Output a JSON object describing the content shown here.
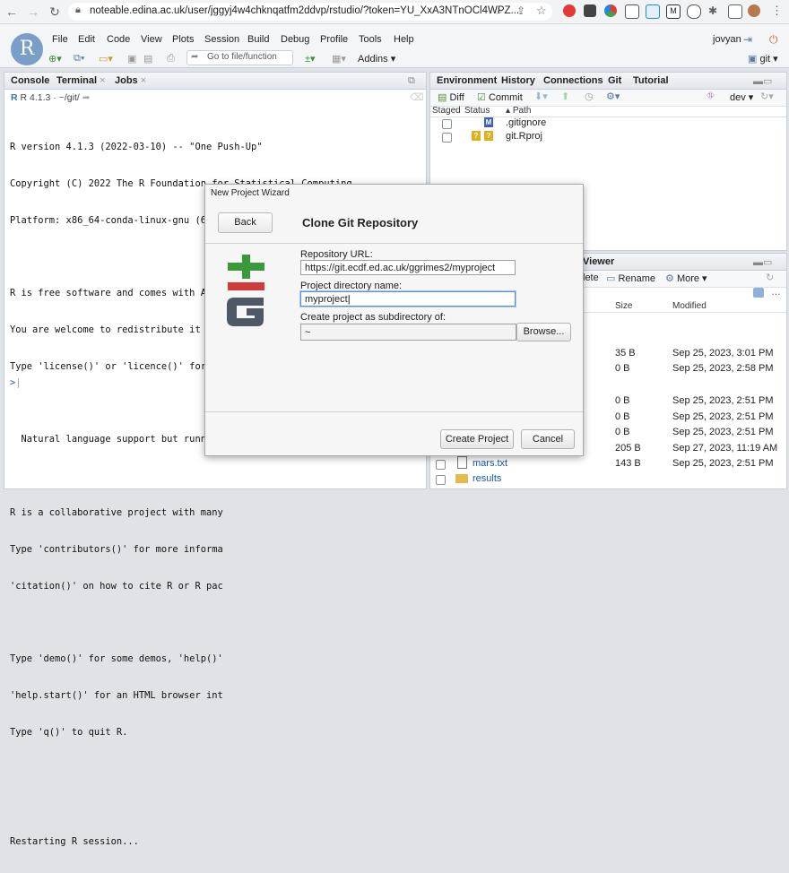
{
  "browser": {
    "url": "noteable.edina.ac.uk/user/jggyj4w4chknqatfm2ddvp/rstudio/?token=YU_XxA3NTnOCl4WPZ...",
    "nav": [
      "back-icon",
      "forward-icon",
      "reload-icon"
    ]
  },
  "rstudio": {
    "menus": [
      "File",
      "Edit",
      "Code",
      "View",
      "Plots",
      "Session",
      "Build",
      "Debug",
      "Profile",
      "Tools",
      "Help"
    ],
    "user": "jovyan",
    "goto_placeholder": "Go to file/function",
    "addins": "Addins",
    "project": "git",
    "logo": "R"
  },
  "console": {
    "tabs": [
      "Console",
      "Terminal",
      "Jobs"
    ],
    "version": "R 4.1.3",
    "path": "~/git/",
    "lines": [
      "R version 4.1.3 (2022-03-10) -- \"One Push-Up\"",
      "Copyright (C) 2022 The R Foundation for Statistical Computing",
      "Platform: x86_64-conda-linux-gnu (64-bit)",
      "",
      "R is free software and comes with ABSOLUTELY NO WARRANTY.",
      "You are welcome to redistribute it under certain conditions.",
      "Type 'license()' or 'licence()' for di",
      "",
      "  Natural language support but running",
      "",
      "R is a collaborative project with many",
      "Type 'contributors()' for more informa",
      "'citation()' on how to cite R or R pac",
      "",
      "Type 'demo()' for some demos, 'help()'",
      "'help.start()' for an HTML browser int",
      "Type 'q()' to quit R.",
      "",
      "",
      "Restarting R session..."
    ],
    "prompt": ">"
  },
  "env": {
    "tabs": [
      "Environment",
      "History",
      "Connections",
      "Git",
      "Tutorial"
    ],
    "diff": "Diff",
    "commit": "Commit",
    "branch": "dev",
    "headers": {
      "staged": "Staged",
      "status": "Status",
      "path": "Path"
    },
    "files": [
      {
        "status": "M",
        "path": ".gitignore"
      },
      {
        "status": "?",
        "path": "git.Rproj"
      }
    ]
  },
  "files": {
    "tab": "Viewer",
    "delete": "lete",
    "rename": "Rename",
    "more": "More",
    "headers": {
      "size": "Size",
      "modified": "Modified"
    },
    "rows": [
      {
        "size": "35 B",
        "modified": "Sep 25, 2023, 3:01 PM"
      },
      {
        "size": "0 B",
        "modified": "Sep 25, 2023, 2:58 PM"
      },
      {
        "size": "0 B",
        "modified": "Sep 25, 2023, 2:51 PM"
      },
      {
        "size": "0 B",
        "modified": "Sep 25, 2023, 2:51 PM"
      },
      {
        "size": "0 B",
        "modified": "Sep 25, 2023, 2:51 PM"
      },
      {
        "size": "205 B",
        "modified": "Sep 27, 2023, 11:19 AM"
      },
      {
        "name": "mars.txt",
        "size": "143 B",
        "modified": "Sep 25, 2023, 2:51 PM"
      },
      {
        "name": "results",
        "size": "",
        "modified": ""
      }
    ]
  },
  "dialog": {
    "title": "New Project Wizard",
    "back": "Back",
    "heading": "Clone Git Repository",
    "repo_label": "Repository URL:",
    "repo_value": "https://git.ecdf.ed.ac.uk/ggrimes2/myproject",
    "dir_label": "Project directory name:",
    "dir_value": "myproject",
    "sub_label": "Create project as subdirectory of:",
    "sub_value": "~",
    "browse": "Browse...",
    "create": "Create Project",
    "cancel": "Cancel",
    "logo_text": "Git"
  }
}
